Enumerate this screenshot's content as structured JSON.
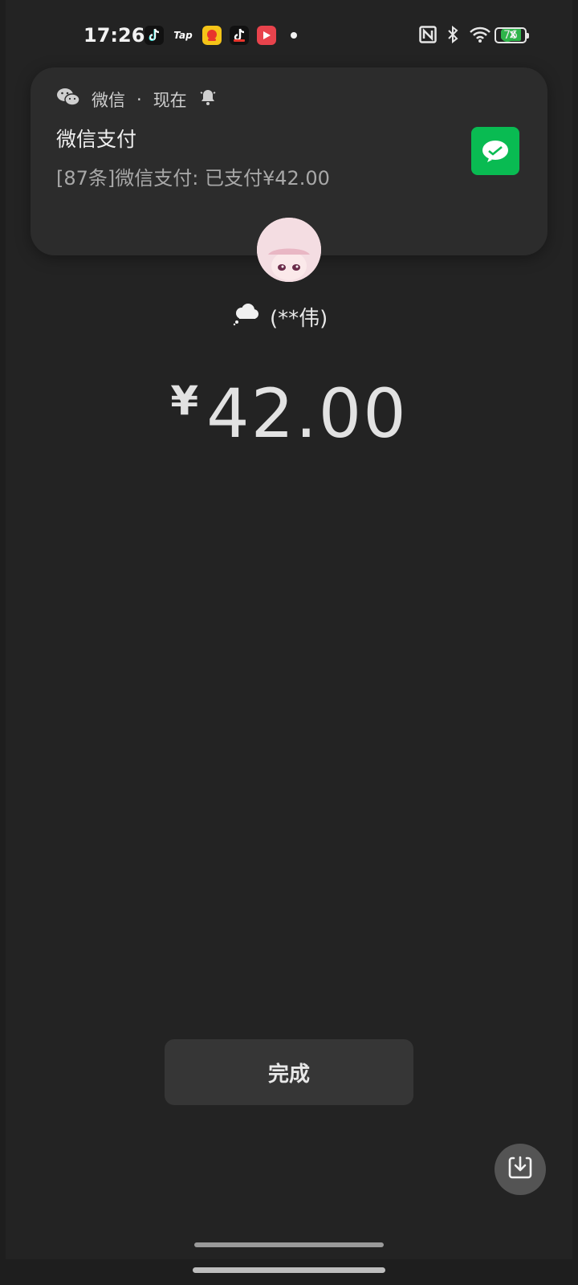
{
  "status_bar": {
    "time": "17:26",
    "battery_level": "76",
    "notification_app_icons": [
      "douyin-icon",
      "taptap-icon",
      "taobao-icon",
      "douyin-lite-icon",
      "video-icon"
    ],
    "system_icons": [
      "nfc-icon",
      "bluetooth-icon",
      "wifi-icon",
      "screen-record-icon"
    ]
  },
  "notification": {
    "app_name": "微信",
    "separator": "·",
    "time": "现在",
    "title": "微信支付",
    "body": "[87条]微信支付: 已支付¥42.00",
    "accent_color": "#09bb52"
  },
  "payment": {
    "payee_name": "(**伟)",
    "currency_symbol": "¥",
    "amount": "42.00"
  },
  "actions": {
    "done_label": "完成"
  },
  "colors": {
    "background": "#232323",
    "card": "#2c2c2c",
    "button": "#363636",
    "wechat_green": "#09bb52"
  }
}
